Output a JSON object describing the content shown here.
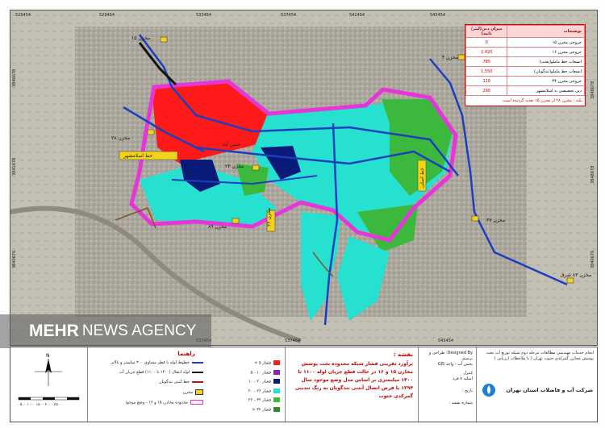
{
  "map": {
    "coords_top": [
      "525454",
      "529454",
      "533454",
      "537454",
      "541454",
      "545454"
    ],
    "coords_bottom": [
      "533454",
      "537454",
      "545454"
    ],
    "coords_left": [
      "3846678",
      "3841678",
      "3840676"
    ],
    "coords_right": [
      "3848678",
      "3848678",
      "3840676"
    ],
    "tanks": {
      "t15": "مخزن ۱۵",
      "t4": "مخزن ۴",
      "t23": "مخزن ۲۳",
      "t28": "مخزن ۲۸",
      "t89": "مخزن ۸۹",
      "t37": "مخزن ۳۷",
      "t83": "مخزن ۸۳ شرق",
      "t26": "مخزن ۲۶"
    },
    "labels": {
      "eslamshahr_line": "خط اسلامشهر",
      "hasanabad": "حسن آباد",
      "line_main": "خط اصلی"
    }
  },
  "info_table": {
    "col_value": "میزان دبی(لیتر/ثانیه)",
    "col_desc": "توضیحات",
    "rows": [
      {
        "desc": "خروجی مخزن ۱۵",
        "value": "0"
      },
      {
        "desc": "خروجی مخزن ۱۶",
        "value": "2,420"
      },
      {
        "desc": "انشعاب خط ماملو(بعثت)",
        "value": "785"
      },
      {
        "desc": "انشعاب خط ماملو(تندگویان)",
        "value": "1,550"
      },
      {
        "desc": "خروجی مخزن ۴۴",
        "value": "120"
      },
      {
        "desc": "دبی تخصیصی به اسلامشهر",
        "value": "290"
      }
    ],
    "note": "نکته : مخزن ۲۸ از مخزن ۱۵ تغذیه گردیده است."
  },
  "watermark": {
    "part1": "MEHR",
    "part2": "NEWS AGENCY"
  },
  "title_block": {
    "legend_title": "راهنما",
    "note_title": "نقشه :",
    "note_text": "برآورد تقریبی فشار شبکه محدوده تحت پوشش مخازن ۱۵ و ۱۶ در حالت قطع جریان لوله ۱۱۰۰ تا ۱۴۰۰ میلیمتری بر اساس مدل وضع موجود سال ۱۳۹۴ با فرض اتصال آنتنی تندگویان به رنگ تندیبی گمرکدی جنوب",
    "designer_label": "Designed By: طراحی و ترسیم",
    "unit": "بخش آب - واحد GIS",
    "checked_label": "کنترل",
    "checked_by": "امیلیه ۸ فرد",
    "date_label": "تاریخ :",
    "sheet_label": "شماره نقشه :",
    "project_text": "انجام خدمات مهندسی مطالعات مرحله دوم شبکه توزیع آب تحت پوشش مخازن گمرکدی جنوب تهران ( با ملاحظات ارزیابی )",
    "client_name": "شرکت آب و فاضلاب استان تهران",
    "legend_left": [
      {
        "label": "خطوط لوله با قطر مساوی ۳۰۰ میلیمتر و بالاتر",
        "color": "#1c3fbf"
      },
      {
        "label": "لوله انتقال (۱۴۰۰ تا ۱۱۰۰) قطع جریان آب",
        "color": "#111111"
      },
      {
        "label": "خط آنتنی تندگویان",
        "color": "#c01010"
      },
      {
        "label": "مخزن",
        "color": "#f2d21a"
      },
      {
        "label": "محدوده مخازن ۱۵ و ۱۶ - وضع موجود",
        "color": "#e636d8"
      }
    ],
    "legend_right": [
      {
        "label": "فشار ۵ >",
        "color": "#ff1a1a"
      },
      {
        "label": "فشار ۱۰ - ۵",
        "color": "#8c1fbf"
      },
      {
        "label": "فشار ۲۰ - ۱۰",
        "color": "#0a1a78"
      },
      {
        "label": "فشار ۲۶ - ۲۰",
        "color": "#26e0d0"
      },
      {
        "label": "فشار ۳۲ - ۲۶",
        "color": "#3cb93c"
      },
      {
        "label": "فشار ۳۲ <",
        "color": "#2e8b2e"
      }
    ],
    "scale_text": "۰ ۵۰۰ ۱۰۰۰ ۱۵۰۰ ۲۰۰۰ ۲۵۰۰",
    "north": "N"
  }
}
